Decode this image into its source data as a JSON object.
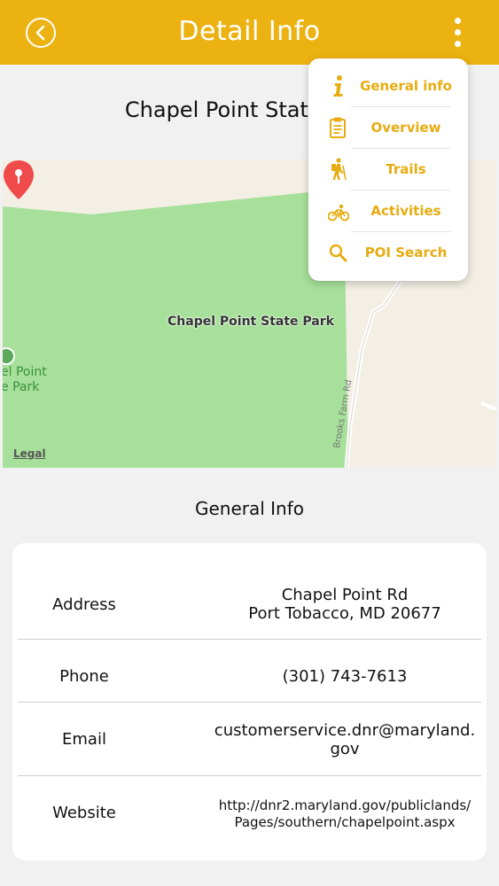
{
  "header": {
    "title": "Detail Info",
    "accent_color": "#ecb211",
    "back_icon": "chevron-left-circle-icon",
    "menu_icon": "kebab-menu-icon"
  },
  "park": {
    "name": "Chapel Point State Park"
  },
  "map": {
    "marker_label": "Chapel Point State Park",
    "side_label_line1": "el Point",
    "side_label_line2": "e Park",
    "road_label": "Brooks Farm Rd",
    "legal": "Legal"
  },
  "menu": {
    "items": [
      {
        "label": "General info",
        "icon": "info-icon"
      },
      {
        "label": "Overview",
        "icon": "clipboard-icon"
      },
      {
        "label": "Trails",
        "icon": "hiker-icon"
      },
      {
        "label": "Activities",
        "icon": "bicycle-icon"
      },
      {
        "label": "POI Search",
        "icon": "search-icon"
      }
    ]
  },
  "info": {
    "section_title": "General Info",
    "address_label": "Address",
    "address_line1": "Chapel Point Rd",
    "address_line2": "Port Tobacco, MD 20677",
    "phone_label": "Phone",
    "phone_value": "(301) 743-7613",
    "email_label": "Email",
    "email_line1": "customerservice.dnr@maryland.",
    "email_line2": "gov",
    "website_label": "Website",
    "website_line1": "http://dnr2.maryland.gov/publiclands/",
    "website_line2": "Pages/southern/chapelpoint.aspx"
  }
}
